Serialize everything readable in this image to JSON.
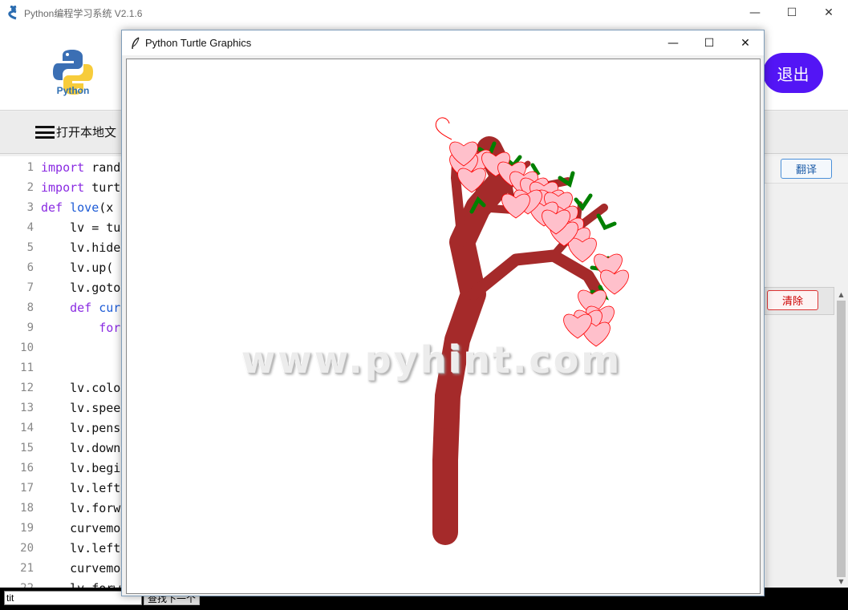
{
  "app": {
    "title": "Python编程学习系统 V2.1.6",
    "logo_text": "Python",
    "exit_label": "退出",
    "menu_label": "打开本地文",
    "translate_label": "翻译",
    "clear_label": "清除",
    "window_controls": {
      "minimize": "—",
      "maximize": "☐",
      "close": "✕"
    }
  },
  "editor": {
    "lines": [
      {
        "no": "1",
        "text": "import rand"
      },
      {
        "no": "2",
        "text": "import turt"
      },
      {
        "no": "3",
        "text": "def love(x"
      },
      {
        "no": "4",
        "text": "    lv = tu"
      },
      {
        "no": "5",
        "text": "    lv.hide"
      },
      {
        "no": "6",
        "text": "    lv.up("
      },
      {
        "no": "7",
        "text": "    lv.goto"
      },
      {
        "no": "8",
        "text": "    def cur"
      },
      {
        "no": "9",
        "text": "        for"
      },
      {
        "no": "10",
        "text": ""
      },
      {
        "no": "11",
        "text": ""
      },
      {
        "no": "12",
        "text": "    lv.colo"
      },
      {
        "no": "13",
        "text": "    lv.spee"
      },
      {
        "no": "14",
        "text": "    lv.pens"
      },
      {
        "no": "15",
        "text": "    lv.down"
      },
      {
        "no": "16",
        "text": "    lv.begi"
      },
      {
        "no": "17",
        "text": "    lv.left"
      },
      {
        "no": "18",
        "text": "    lv.forw"
      },
      {
        "no": "19",
        "text": "    curvemo"
      },
      {
        "no": "20",
        "text": "    lv.left"
      },
      {
        "no": "21",
        "text": "    curvemo"
      },
      {
        "no": "22",
        "text": "    lv.forw"
      }
    ]
  },
  "search": {
    "value": "tit",
    "find_next_label": "查找下一个"
  },
  "turtle_window": {
    "title": "Python Turtle Graphics",
    "watermark": "www.pyhint.com",
    "colors": {
      "trunk": "#a52a2a",
      "leaf": "#008000",
      "heart_fill": "#ffc0cb",
      "heart_stroke": "#ff0000"
    }
  }
}
